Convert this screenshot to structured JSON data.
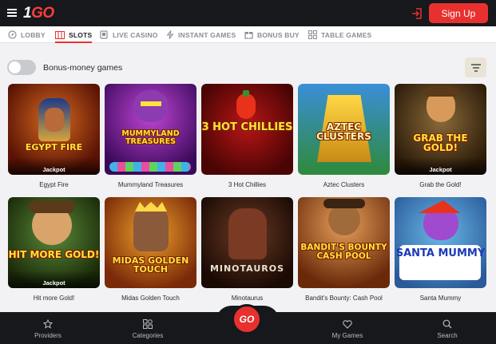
{
  "header": {
    "logo_main": "1",
    "logo_accent": "GO",
    "signup_label": "Sign Up"
  },
  "nav": {
    "items": [
      {
        "label": "LOBBY",
        "icon": "compass-icon"
      },
      {
        "label": "SLOTS",
        "icon": "slot-machine-icon",
        "active": true
      },
      {
        "label": "LIVE CASINO",
        "icon": "cards-icon"
      },
      {
        "label": "INSTANT GAMES",
        "icon": "lightning-icon"
      },
      {
        "label": "BONUS BUY",
        "icon": "gift-icon"
      },
      {
        "label": "TABLE GAMES",
        "icon": "grid-icon"
      }
    ]
  },
  "filters": {
    "bonus_toggle_label": "Bonus-money games",
    "bonus_toggle_on": false
  },
  "games": [
    {
      "name": "Egypt Fire",
      "jackpot": "Jackpot",
      "art": "EGYPT FIRE"
    },
    {
      "name": "Mummyland Treasures",
      "jackpot": "",
      "art": "MUMMYLAND TREASURES"
    },
    {
      "name": "3 Hot Chillies",
      "jackpot": "",
      "art": "3 HOT CHILLIES"
    },
    {
      "name": "Aztec Clusters",
      "jackpot": "",
      "art": "AZTEC CLUSTERS"
    },
    {
      "name": "Grab the Gold!",
      "jackpot": "Jackpot",
      "art": "GRAB THE GOLD!"
    },
    {
      "name": "Hit more Gold!",
      "jackpot": "Jackpot",
      "art": "HIT MORE GOLD!"
    },
    {
      "name": "Midas Golden Touch",
      "jackpot": "",
      "art": "MIDAS GOLDEN TOUCH"
    },
    {
      "name": "Minotaurus",
      "jackpot": "",
      "art": "MINOTAUROS"
    },
    {
      "name": "Bandit's Bounty: Cash Pool",
      "jackpot": "",
      "art": "BANDIT'S BOUNTY CASH POOL"
    },
    {
      "name": "Santa Mummy",
      "jackpot": "",
      "art": "SANTA MUMMY"
    }
  ],
  "bottom_nav": {
    "providers": "Providers",
    "categories": "Categories",
    "go": "GO",
    "my_games": "My Games",
    "search": "Search"
  },
  "colors": {
    "brand_red": "#e8312f",
    "header_bg": "#16181c",
    "page_bg": "#f2f2f4"
  }
}
